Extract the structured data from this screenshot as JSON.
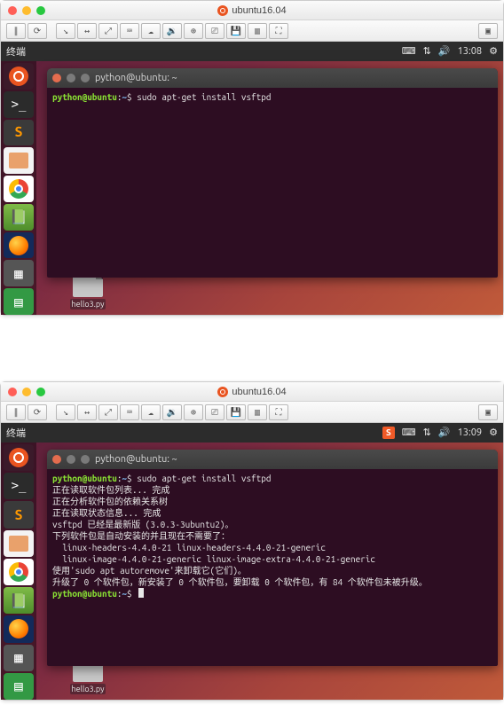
{
  "vm_title": "ubuntu16.04",
  "vm_toolbar_icons": [
    "pause",
    "stop",
    "snapshot",
    "swap",
    "rewind",
    "keyboard",
    "audio",
    "network",
    "usb",
    "disk",
    "save",
    "display",
    "full"
  ],
  "top": {
    "panel_left": "终端",
    "time": "13:08",
    "indicators": [
      "keyboard",
      "network",
      "volume",
      "time",
      "gear"
    ],
    "term_title": "python@ubuntu: ~",
    "desktop_file": "hello3.py",
    "term": {
      "lines": [
        {
          "prompt": "python@ubuntu",
          "path": "~",
          "cmd": "sudo apt-get install vsftpd"
        }
      ]
    }
  },
  "bottom": {
    "panel_left": "终端",
    "time": "13:09",
    "indicators_extra": "sogou",
    "term_title": "python@ubuntu: ~",
    "desktop_file": "hello3.py",
    "term": {
      "lines": [
        {
          "prompt": "python@ubuntu",
          "path": "~",
          "cmd": "sudo apt-get install vsftpd"
        },
        {
          "out": "正在读取软件包列表... 完成"
        },
        {
          "out": "正在分析软件包的依赖关系树"
        },
        {
          "out": "正在读取状态信息... 完成"
        },
        {
          "out": "vsftpd 已经是最新版 (3.0.3-3ubuntu2)。"
        },
        {
          "out": "下列软件包是自动安装的并且现在不需要了："
        },
        {
          "out": "  linux-headers-4.4.0-21 linux-headers-4.4.0-21-generic"
        },
        {
          "out": "  linux-image-4.4.0-21-generic linux-image-extra-4.4.0-21-generic"
        },
        {
          "out": "使用'sudo apt autoremove'来卸载它(它们)。"
        },
        {
          "out": "升级了 0 个软件包，新安装了 0 个软件包，要卸载 0 个软件包，有 84 个软件包未被升级。"
        },
        {
          "prompt": "python@ubuntu",
          "path": "~",
          "cmd": "",
          "cursor": true
        }
      ]
    }
  },
  "launcher_icons": [
    "dash-ubuntu",
    "terminal",
    "sublime",
    "files",
    "chrome",
    "book",
    "firefox",
    "misc1",
    "misc2"
  ]
}
